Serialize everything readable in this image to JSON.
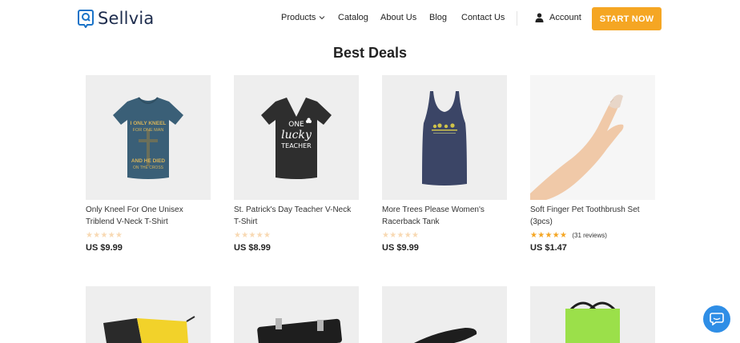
{
  "brand": {
    "name": "Sellvia"
  },
  "nav": {
    "products": "Products",
    "catalog": "Catalog",
    "about": "About Us",
    "blog": "Blog",
    "contact": "Contact Us",
    "account": "Account",
    "cta": "START NOW"
  },
  "section": {
    "title": "Best Deals"
  },
  "products": [
    {
      "title": "Only Kneel For One Unisex Triblend V-Neck T-Shirt",
      "price": "US $9.99",
      "stars": "★★★★★",
      "reviews": ""
    },
    {
      "title": "St. Patrick's Day Teacher V-Neck T-Shirt",
      "price": "US $8.99",
      "stars": "★★★★★",
      "reviews": ""
    },
    {
      "title": "More Trees Please Women's Racerback Tank",
      "price": "US $9.99",
      "stars": "★★★★★",
      "reviews": ""
    },
    {
      "title": "Soft Finger Pet Toothbrush Set (3pcs)",
      "price": "US $1.47",
      "stars": "★★★★★",
      "reviews": "(31 reviews)"
    }
  ],
  "print_text": {
    "shirt1_top": "I ONLY KNEEL",
    "shirt1_mid": "FOR ONE MAN",
    "shirt1_bottom": "AND HE DIED",
    "shirt1_tag": "ON THE CROSS",
    "shirt2_a": "ONE",
    "shirt2_b": "lucky",
    "shirt2_c": "TEACHER"
  },
  "colors": {
    "accent": "#f5a623",
    "brand_blue": "#1a73c8",
    "chat_blue": "#2f8ee6",
    "star_empty": "#f8d9b3"
  }
}
